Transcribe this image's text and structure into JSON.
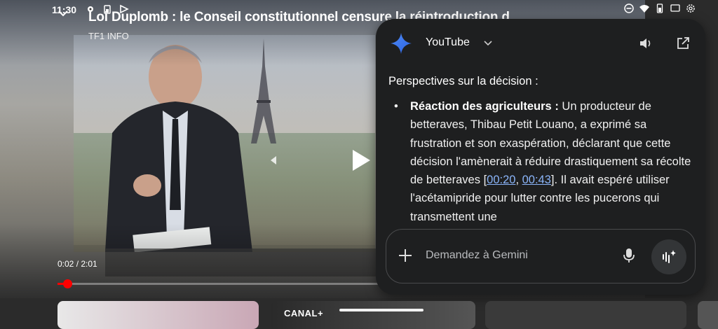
{
  "status_bar": {
    "time": "11:30"
  },
  "video": {
    "title": "Loi Duplomb : le Conseil constitutionnel censure la réintroduction de",
    "channel": "TF1 INFO",
    "current_time": "0:02",
    "duration": "2:01",
    "progress_fraction": 0.017
  },
  "gemini": {
    "app_name": "YouTube",
    "heading": "Perspectives sur la décision :",
    "bullet_bold": "Réaction des agriculteurs :",
    "bullet_text_1": " Un producteur de betteraves, Thibau Petit Louano, a exprimé sa frustration et son exaspération, déclarant que cette décision l'amènerait à réduire drastiquement sa récolte de betteraves [",
    "timestamp_1": "00:20",
    "separator": ", ",
    "timestamp_2": "00:43",
    "bullet_text_2": "]. Il avait espéré utiliser l'acétamipride pour lutter contre les pucerons qui transmettent une",
    "input_placeholder": "Demandez à Gemini"
  },
  "thumbnails": {
    "t2_brand": "CANAL+"
  },
  "icons": {
    "gemini": "gemini-sparkle-icon",
    "chevron": "chevron-down-icon",
    "speaker": "speaker-icon",
    "open": "open-external-icon",
    "plus": "plus-icon",
    "mic": "microphone-icon",
    "live": "gemini-live-icon"
  }
}
